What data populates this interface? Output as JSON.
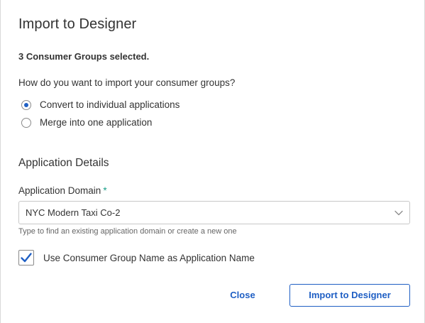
{
  "dialog": {
    "title": "Import to Designer",
    "selected_count": "3 Consumer Groups selected.",
    "question": "How do you want to import your consumer groups?",
    "import_options": [
      {
        "label": "Convert to individual applications",
        "selected": true
      },
      {
        "label": "Merge into one application",
        "selected": false
      }
    ],
    "section_title": "Application Details",
    "domain_field": {
      "label": "Application Domain",
      "required_marker": "*",
      "value": "NYC Modern Taxi Co-2",
      "helper": "Type to find an existing application domain or create a new one"
    },
    "use_group_name": {
      "label": "Use Consumer Group Name as Application Name",
      "checked": true
    },
    "buttons": {
      "close": "Close",
      "import": "Import to Designer"
    }
  },
  "colors": {
    "accent": "#1f5fc4",
    "required": "#1aa08a",
    "text": "#333333",
    "helper_text": "#666666",
    "border": "#c8c8c8"
  },
  "icons": {
    "dropdown": "chevron-down-icon",
    "checkbox_mark": "checkmark-icon"
  }
}
